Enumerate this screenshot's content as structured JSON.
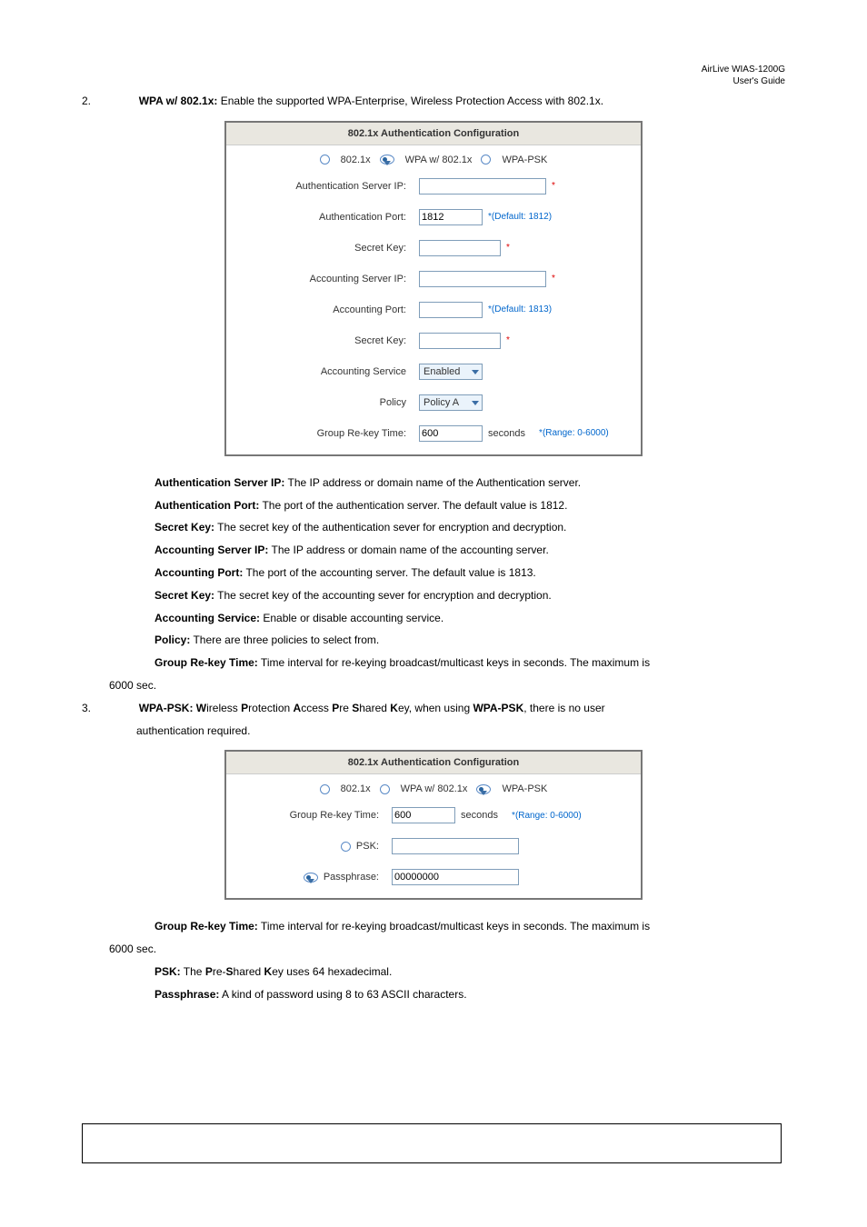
{
  "header": {
    "brand": "AirLive  WIAS-1200G",
    "doc": "User's Guide"
  },
  "sec2": {
    "num": "2.",
    "lead": "WPA w/ 802.1x:",
    "tail": " Enable the supported WPA-Enterprise, Wireless Protection Access with 802.1x."
  },
  "fig1": {
    "title": "802.1x Authentication Configuration",
    "radios": {
      "a": "802.1x",
      "b": "WPA w/ 802.1x",
      "c": "WPA-PSK"
    },
    "rows": {
      "authIP": {
        "label": "Authentication Server IP:",
        "val": "",
        "hint": "*"
      },
      "authPort": {
        "label": "Authentication Port:",
        "val": "1812",
        "hint": "*(Default: 1812)"
      },
      "secret1": {
        "label": "Secret Key:",
        "val": "",
        "hint": "*"
      },
      "acctIP": {
        "label": "Accounting Server IP:",
        "val": "",
        "hint": "*"
      },
      "acctPort": {
        "label": "Accounting Port:",
        "val": "",
        "hint": "*(Default: 1813)"
      },
      "secret2": {
        "label": "Secret Key:",
        "val": "",
        "hint": "*"
      },
      "acctSvc": {
        "label": "Accounting Service",
        "val": "Enabled"
      },
      "policy": {
        "label": "Policy",
        "val": "Policy A"
      },
      "rekey": {
        "label": "Group Re-key Time:",
        "val": "600",
        "unit": "seconds",
        "hint": "*(Range: 0-6000)"
      }
    }
  },
  "desc2": {
    "authIP": {
      "b": "Authentication Server IP:",
      "t": " The IP address or domain name of the Authentication server."
    },
    "authPort": {
      "b": "Authentication Port:",
      "t": " The port of the authentication server. The default value is 1812."
    },
    "secret1": {
      "b": "Secret Key:",
      "t": " The secret key of the authentication sever for encryption and decryption."
    },
    "acctIP": {
      "b": "Accounting Server IP:",
      "t": " The IP address or domain name of the accounting server."
    },
    "acctPort": {
      "b": "Accounting Port:",
      "t": " The port of the accounting server. The default value is 1813."
    },
    "secret2": {
      "b": "Secret Key:",
      "t": " The secret key of the accounting sever for encryption and decryption."
    },
    "acctSvc": {
      "b": "Accounting Service:",
      "t": " Enable or disable accounting service."
    },
    "policy": {
      "b": "Policy:",
      "t": " There are three policies to select from."
    },
    "rekey1": {
      "b": "Group Re-key Time:",
      "t": " Time interval for re-keying broadcast/multicast keys in seconds. The maximum is"
    },
    "rekey2": "6000 sec."
  },
  "sec3": {
    "num": "3.",
    "lead": "WPA-PSK: W",
    "mid1": "ireless ",
    "b1": "P",
    "mid2": "rotection ",
    "b2": "A",
    "mid3": "ccess ",
    "b3": "P",
    "mid4": "re ",
    "b4": "S",
    "mid5": "hared ",
    "b5": "K",
    "mid6": "ey, when using ",
    "lead2": "WPA-PSK",
    "tail": ", there is no user",
    "tail2": "authentication required."
  },
  "fig2": {
    "title": "802.1x Authentication Configuration",
    "radios": {
      "a": "802.1x",
      "b": "WPA w/ 802.1x",
      "c": "WPA-PSK"
    },
    "rows": {
      "rekey": {
        "label": "Group Re-key Time:",
        "val": "600",
        "unit": "seconds",
        "hint": "*(Range: 0-6000)"
      },
      "psk": {
        "label": "PSK:",
        "val": ""
      },
      "pass": {
        "label": "Passphrase:",
        "val": "00000000"
      }
    }
  },
  "desc3": {
    "rekey1": {
      "b": "Group Re-key Time:",
      "t": " Time interval for re-keying broadcast/multicast keys in seconds. The maximum is"
    },
    "rekey2": "6000 sec.",
    "psk": {
      "b": "PSK:",
      "t1": " The ",
      "b2": "P",
      "t2": "re-",
      "b3": "S",
      "t3": "hared ",
      "b4": "K",
      "t4": "ey uses 64 hexadecimal."
    },
    "pass": {
      "b": "Passphrase:",
      "t": " A kind of password using 8 to 63 ASCII characters."
    }
  }
}
